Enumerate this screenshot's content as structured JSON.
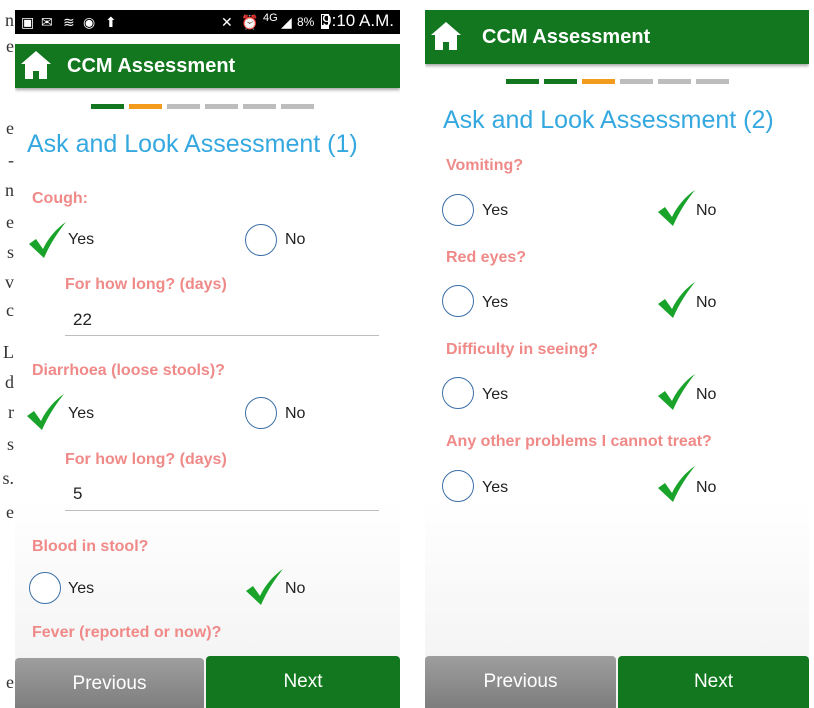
{
  "background_doc": {
    "letters": [
      "n",
      "e",
      "e",
      "-",
      "n",
      "e",
      "s",
      "v",
      "c",
      "L",
      "d",
      "r",
      "s",
      "s.",
      "e",
      "e"
    ]
  },
  "status_bar": {
    "network": "4G",
    "battery": "8%",
    "time": "9:10 A.M."
  },
  "left_screen": {
    "app_title": "CCM Assessment",
    "progress": {
      "total_steps": 6,
      "completed": 1,
      "current_step": 2
    },
    "section_title": "Ask and Look Assessment (1)",
    "questions": [
      {
        "label": "Cough:",
        "yes": "Yes",
        "no": "No",
        "selected": "Yes",
        "followup": {
          "label": "For how long? (days)",
          "value": "22"
        }
      },
      {
        "label": "Diarrhoea (loose stools)?",
        "yes": "Yes",
        "no": "No",
        "selected": "Yes",
        "followup": {
          "label": "For how long? (days)",
          "value": "5"
        }
      },
      {
        "label": "Blood in stool?",
        "yes": "Yes",
        "no": "No",
        "selected": "No"
      },
      {
        "label": "Fever (reported or now)?"
      }
    ],
    "buttons": {
      "previous": "Previous",
      "next": "Next"
    }
  },
  "right_screen": {
    "app_title": "CCM Assessment",
    "progress": {
      "total_steps": 6,
      "completed": 2,
      "current_step": 3
    },
    "section_title": "Ask and Look Assessment (2)",
    "questions": [
      {
        "label": "Vomiting?",
        "yes": "Yes",
        "no": "No",
        "selected": "No"
      },
      {
        "label": "Red eyes?",
        "yes": "Yes",
        "no": "No",
        "selected": "No"
      },
      {
        "label": "Difficulty in seeing?",
        "yes": "Yes",
        "no": "No",
        "selected": "No"
      },
      {
        "label": "Any other problems I cannot treat?",
        "yes": "Yes",
        "no": "No",
        "selected": "No"
      }
    ],
    "buttons": {
      "previous": "Previous",
      "next": "Next"
    }
  },
  "colors": {
    "app_bar": "#12771e",
    "title_blue": "#34a8df",
    "question_pink": "#ef8a88",
    "progress_orange": "#f29b1c",
    "check_green": "#1aa32a"
  },
  "icons": [
    "home-icon",
    "check-icon",
    "radio-circle-icon",
    "wifi-icon",
    "alarm-icon",
    "battery-icon"
  ]
}
